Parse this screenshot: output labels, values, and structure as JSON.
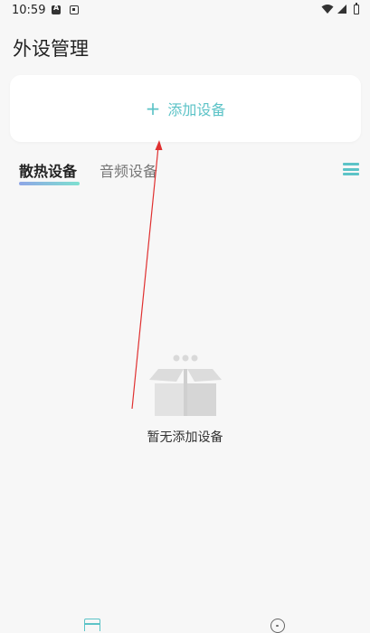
{
  "status_bar": {
    "time": "10:59"
  },
  "header": {
    "title": "外设管理"
  },
  "add_device": {
    "label": "添加设备"
  },
  "tabs": [
    {
      "label": "散热设备",
      "active": true
    },
    {
      "label": "音频设备",
      "active": false
    }
  ],
  "empty_state": {
    "text": "暂无添加设备"
  },
  "colors": {
    "accent": "#5cc3c7",
    "annotation_arrow": "#e03030"
  }
}
